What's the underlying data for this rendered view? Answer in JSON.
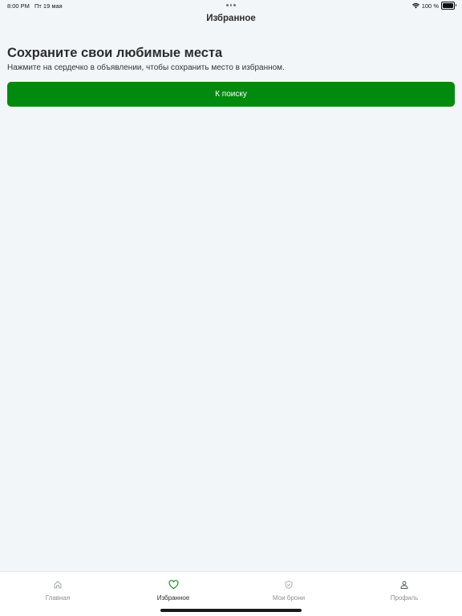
{
  "status_bar": {
    "time": "8:00 PM",
    "date": "Пт 19 мая",
    "battery": "100 %",
    "battery_level": 1.0
  },
  "nav": {
    "title": "Избранное"
  },
  "empty_state": {
    "headline": "Сохраните свои любимые места",
    "subtitle": "Нажмите на сердечко в объявлении, чтобы сохранить место в избранном.",
    "button_label": "К поиску"
  },
  "tabs": [
    {
      "label": "Главная",
      "icon": "home-icon",
      "active": false
    },
    {
      "label": "Избранное",
      "icon": "heart-icon",
      "active": true
    },
    {
      "label": "Мои брони",
      "icon": "shield-check-icon",
      "active": false
    },
    {
      "label": "Профиль",
      "icon": "person-icon",
      "active": false
    }
  ],
  "colors": {
    "accent": "#008a0e",
    "background": "#f3f6f9",
    "tab_inactive": "#8a8f95"
  }
}
